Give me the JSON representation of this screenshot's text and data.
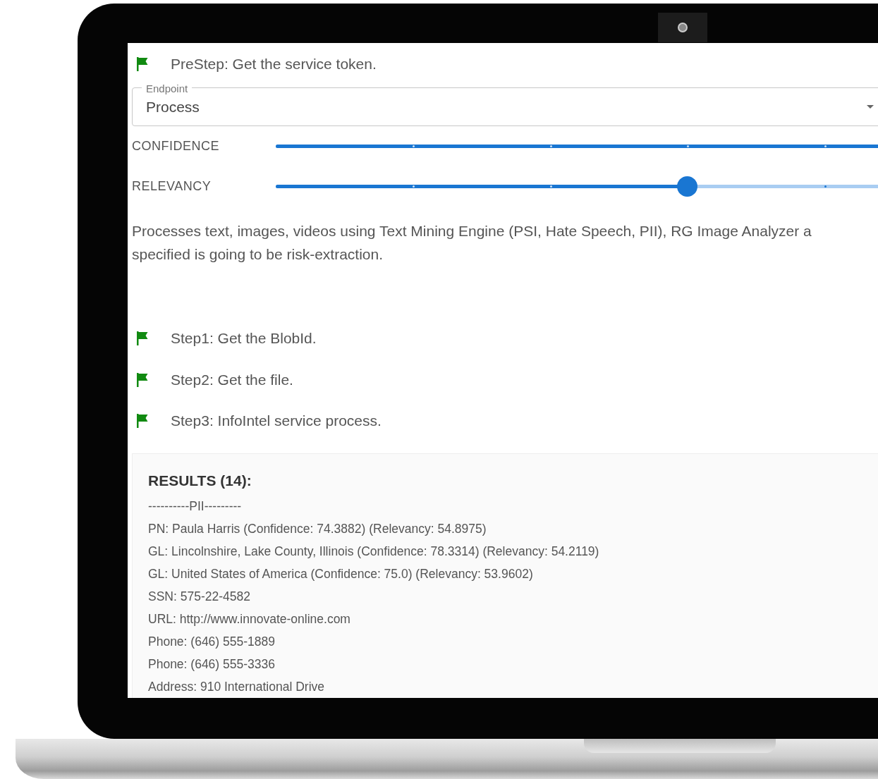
{
  "prestep": {
    "label": "PreStep: Get the service token."
  },
  "endpoint": {
    "label": "Endpoint",
    "value": "Process"
  },
  "sliders": [
    {
      "label": "CONFIDENCE",
      "level": 1
    },
    {
      "label": "RELEVANCY",
      "level": 0.6
    }
  ],
  "description_lines": [
    "Processes text, images, videos using Text Mining Engine (PSI, Hate Speech, PII), RG Image Analyzer a",
    "specified is going to be risk-extraction."
  ],
  "steps": [
    {
      "label": "Step1: Get the BlobId."
    },
    {
      "label": "Step2: Get the file."
    },
    {
      "label": "Step3: InfoIntel service process."
    }
  ],
  "results": {
    "title": "RESULTS (14):",
    "lines": [
      "----------PII---------",
      "PN: Paula Harris (Confidence: 74.3882) (Relevancy: 54.8975)",
      "GL: Lincolnshire, Lake County, Illinois (Confidence: 78.3314) (Relevancy: 54.2119)",
      "GL: United States of America (Confidence: 75.0) (Relevancy: 53.9602)",
      "SSN: 575-22-4582",
      "URL: http://www.innovate-online.com",
      "Phone: (646) 555-1889",
      "Phone: (646) 555-3336",
      "Address: 910 International Drive"
    ]
  }
}
